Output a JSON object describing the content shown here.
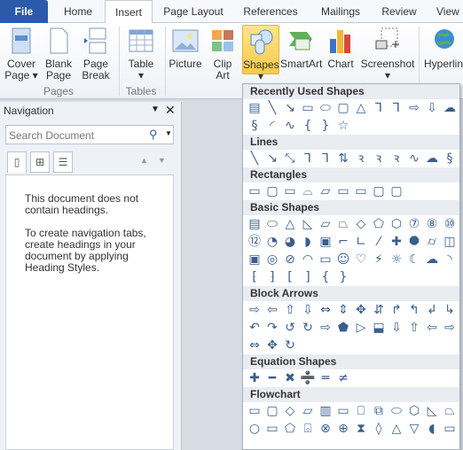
{
  "tabs": [
    {
      "label": "File"
    },
    {
      "label": "Home"
    },
    {
      "label": "Insert"
    },
    {
      "label": "Page Layout"
    },
    {
      "label": "References"
    },
    {
      "label": "Mailings"
    },
    {
      "label": "Review"
    },
    {
      "label": "View"
    }
  ],
  "ribbon": {
    "buttons": [
      {
        "label": "Cover Page ▾"
      },
      {
        "label": "Blank Page"
      },
      {
        "label": "Page Break"
      },
      {
        "label": "Table ▾"
      },
      {
        "label": "Picture"
      },
      {
        "label": "Clip Art"
      },
      {
        "label": "Shapes ▾"
      },
      {
        "label": "SmartArt"
      },
      {
        "label": "Chart"
      },
      {
        "label": "Screenshot ▾"
      },
      {
        "label": "Hyperlink"
      }
    ],
    "groups": [
      {
        "label": "Pages"
      },
      {
        "label": "Tables"
      }
    ]
  },
  "navigation": {
    "title": "Navigation",
    "search_placeholder": "Search Document",
    "message1": "This document does not contain headings.",
    "message2": "To create navigation tabs, create headings in your document by applying Heading Styles."
  },
  "shapes_menu": {
    "sections": [
      {
        "title": "Recently Used Shapes",
        "rows": [
          [
            "▤",
            "╲",
            "↘",
            "▭",
            "⬭",
            "▢",
            "△",
            "⅂",
            "⅂",
            "⇨",
            "⇩",
            "☁"
          ],
          [
            "§",
            "◜",
            "∿",
            "{",
            "}",
            "☆"
          ]
        ]
      },
      {
        "title": "Lines",
        "rows": [
          [
            "╲",
            "↘",
            "⤡",
            "⅂",
            "⅂",
            "⇅",
            "ꝛ",
            "ꝛ",
            "ꝛ",
            "∿",
            "☁",
            "§"
          ]
        ]
      },
      {
        "title": "Rectangles",
        "rows": [
          [
            "▭",
            "▢",
            "▭",
            "⌓",
            "▱",
            "▭",
            "▭",
            "▢",
            "▢"
          ]
        ]
      },
      {
        "title": "Basic Shapes",
        "rows": [
          [
            "▤",
            "⬭",
            "△",
            "◺",
            "▱",
            "⏢",
            "◇",
            "⬠",
            "⬡",
            "⑦",
            "⑧",
            "⑩"
          ],
          [
            "⑫",
            "◔",
            "◕",
            "◗",
            "▣",
            "⌐",
            "∟",
            "⁄",
            "✚",
            "⯃",
            "⌭",
            "◫"
          ],
          [
            "▣",
            "◎",
            "⊘",
            "◠",
            "▭",
            "☺",
            "♡",
            "⚡",
            "☼",
            "☾",
            "☁",
            "◝"
          ],
          [
            "⁅",
            "⁆",
            "[",
            "]",
            "{",
            "}"
          ]
        ]
      },
      {
        "title": "Block Arrows",
        "rows": [
          [
            "⇨",
            "⇦",
            "⇧",
            "⇩",
            "⇔",
            "⇕",
            "✥",
            "⇵",
            "↱",
            "↰",
            "↲",
            "↳"
          ],
          [
            "↶",
            "↷",
            "↺",
            "↻",
            "⇨",
            "⬟",
            "▷",
            "⬓",
            "⇩",
            "⇧",
            "⇦",
            "⇨"
          ],
          [
            "⇔",
            "✥",
            "↻"
          ]
        ]
      },
      {
        "title": "Equation Shapes",
        "rows": [
          [
            "✚",
            "━",
            "✖",
            "➗",
            "═",
            "≠"
          ]
        ]
      },
      {
        "title": "Flowchart",
        "rows": [
          [
            "▭",
            "▢",
            "◇",
            "▱",
            "▥",
            "▭",
            "⎕",
            "⧉",
            "⬭",
            "⬡",
            "◺",
            "⏢"
          ],
          [
            "○",
            "▭",
            "⬠",
            "⌺",
            "⊗",
            "⊕",
            "⧗",
            "◊",
            "△",
            "▽",
            "◖",
            "▭"
          ]
        ]
      }
    ]
  }
}
